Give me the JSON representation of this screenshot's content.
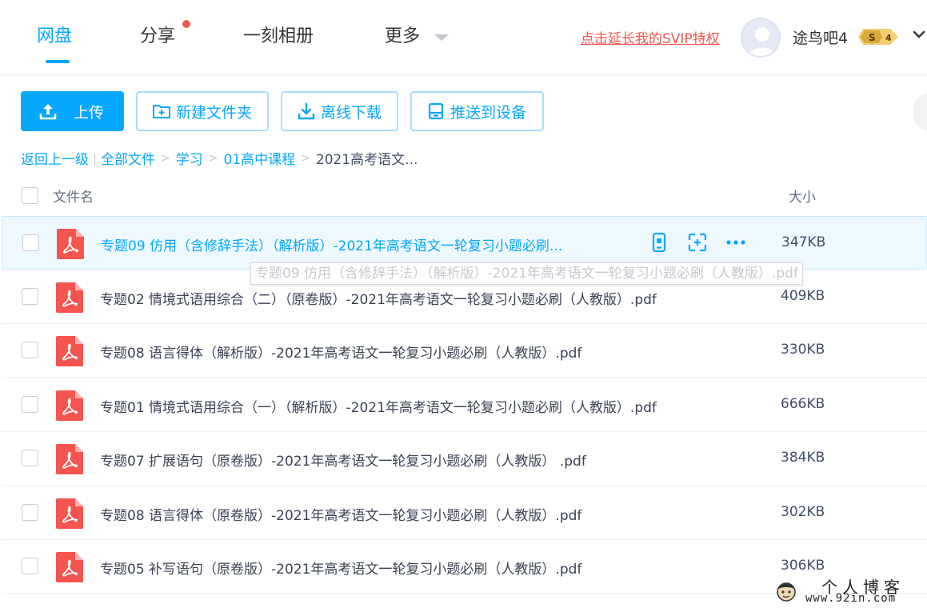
{
  "nav": {
    "tabs": [
      {
        "label": "网盘",
        "active": true
      },
      {
        "label": "分享",
        "has_dot": true
      },
      {
        "label": "一刻相册"
      },
      {
        "label": "更多"
      }
    ],
    "svip_link": "点击延长我的SVIP特权",
    "username": "途鸟吧4",
    "svip_level": "4",
    "svip_symbol": "S"
  },
  "toolbar": {
    "upload": "上传",
    "new_folder": "新建文件夹",
    "offline_download": "离线下载",
    "push_device": "推送到设备"
  },
  "breadcrumb": {
    "back": "返回上一级",
    "items": [
      "全部文件",
      "学习",
      "01高中课程"
    ],
    "current": "2021高考语文..."
  },
  "columns": {
    "name": "文件名",
    "size": "大小"
  },
  "files": [
    {
      "name": "专题09 仿用（含修辞手法）（解析版）-2021年高考语文一轮复习小题必刷...",
      "size": "347KB"
    },
    {
      "name": "专题02 情境式语用综合（二）（原卷版）-2021年高考语文一轮复习小题必刷（人教版）.pdf",
      "size": "409KB"
    },
    {
      "name": "专题08 语言得体（解析版）-2021年高考语文一轮复习小题必刷（人教版）.pdf",
      "size": "330KB"
    },
    {
      "name": "专题01 情境式语用综合（一）（解析版）-2021年高考语文一轮复习小题必刷（人教版）.pdf",
      "size": "666KB"
    },
    {
      "name": "专题07 扩展语句（原卷版）-2021年高考语文一轮复习小题必刷（人教版） .pdf",
      "size": "384KB"
    },
    {
      "name": "专题08 语言得体（原卷版）-2021年高考语文一轮复习小题必刷（人教版）.pdf",
      "size": "302KB"
    },
    {
      "name": "专题05 补写语句（原卷版）-2021年高考语文一轮复习小题必刷（人教版）.pdf",
      "size": "306KB"
    }
  ],
  "tooltip": "专题09 仿用（含修辞手法）（解析版）-2021年高考语文一轮复习小题必刷（人教版）.pdf",
  "watermark": {
    "title": "个人博客",
    "url": "www.92in.com"
  },
  "colors": {
    "accent": "#06a7ff",
    "pdf": "#f5554f",
    "svip_red": "#f5554f"
  }
}
